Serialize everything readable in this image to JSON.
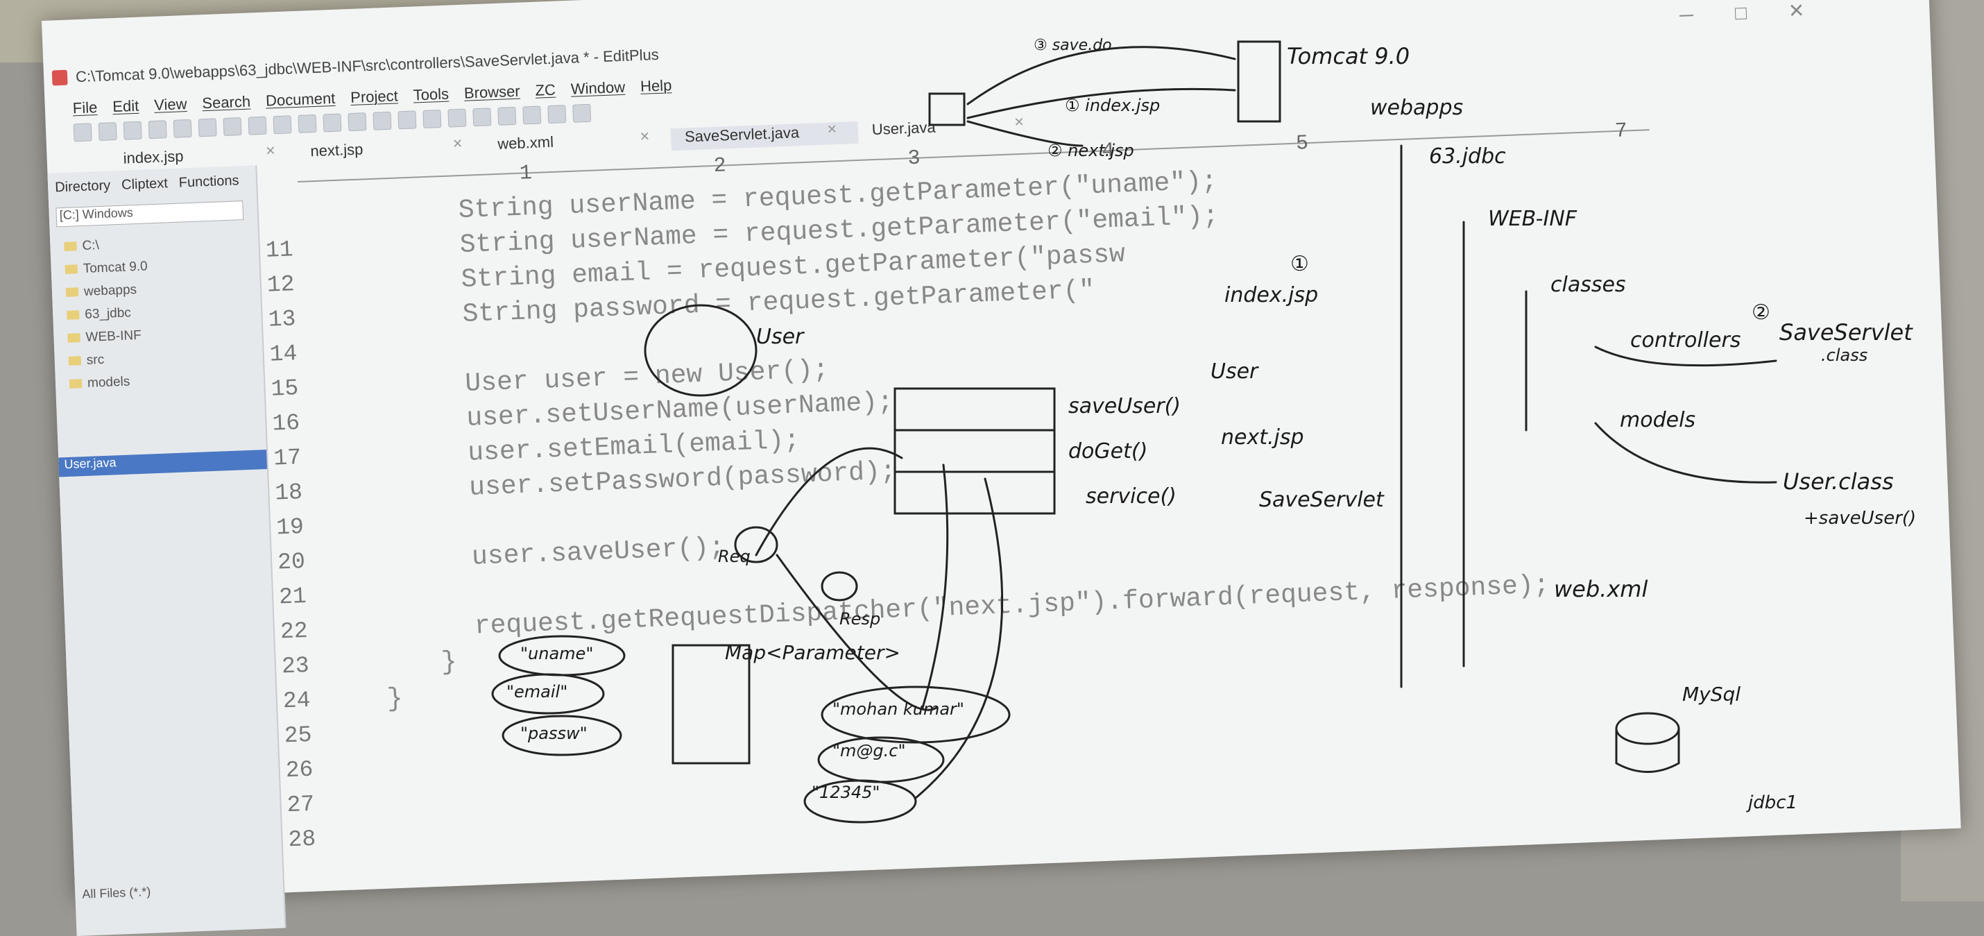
{
  "window": {
    "title": "C:\\Tomcat 9.0\\webapps\\63_jdbc\\WEB-INF\\src\\controllers\\SaveServlet.java * - EditPlus",
    "controls": [
      "─",
      "□",
      "✕"
    ]
  },
  "menu": [
    "File",
    "Edit",
    "View",
    "Search",
    "Document",
    "Project",
    "Tools",
    "Browser",
    "ZC",
    "Window",
    "Help"
  ],
  "tabs": [
    {
      "label": "index.jsp",
      "active": false
    },
    {
      "label": "next.jsp",
      "active": false
    },
    {
      "label": "web.xml",
      "active": false
    },
    {
      "label": "SaveServlet.java",
      "active": true
    },
    {
      "label": "User.java",
      "active": false
    }
  ],
  "sidebar": {
    "tabs": [
      "Directory",
      "Cliptext",
      "Functions"
    ],
    "drive": "[C:] Windows",
    "tree": [
      "C:\\",
      "Tomcat 9.0",
      "webapps",
      "63_jdbc",
      "WEB-INF",
      "src",
      "models"
    ],
    "selected_file": "User.java",
    "filter": "All Files (*.*)"
  },
  "ruler": [
    "1",
    "2",
    "3",
    "4",
    "5",
    "7"
  ],
  "code": [
    {
      "n": "",
      "text": "String userName = request.getParameter(\"uname\");"
    },
    {
      "n": "11",
      "text": "String userName = request.getParameter(\"email\");"
    },
    {
      "n": "12",
      "text": "String email = request.getParameter(\"passw"
    },
    {
      "n": "13",
      "text": "String password = request.getParameter(\""
    },
    {
      "n": "14",
      "text": ""
    },
    {
      "n": "15",
      "text": "User user = new User();"
    },
    {
      "n": "16",
      "text": "user.setUserName(userName);"
    },
    {
      "n": "17",
      "text": "user.setEmail(email);"
    },
    {
      "n": "18",
      "text": "user.setPassword(password);"
    },
    {
      "n": "19",
      "text": ""
    },
    {
      "n": "20",
      "text": "user.saveUser();"
    },
    {
      "n": "21",
      "text": ""
    },
    {
      "n": "22",
      "text": "request.getRequestDispatcher(\"next.jsp\").forward(request, response);"
    },
    {
      "n": "23",
      "text": "}"
    },
    {
      "n": "24",
      "text": "}"
    },
    {
      "n": "25",
      "text": ""
    },
    {
      "n": "26",
      "text": ""
    },
    {
      "n": "27",
      "text": ""
    },
    {
      "n": "28",
      "text": ""
    }
  ],
  "annotations": {
    "tomcat": "Tomcat 9.0",
    "webapps": "webapps",
    "jdbc": "63.jdbc",
    "webinf": "WEB-INF",
    "classes": "classes",
    "controllers": "controllers",
    "models": "models",
    "saveservlet": "SaveServlet",
    "saveservlet_ext": ".class",
    "userclass": "User.class",
    "saveuser_method": "+saveUser()",
    "webxml": "web.xml",
    "indexjsp": "index.jsp",
    "nextjsp": "next.jsp",
    "mysql": "MySql",
    "jdbc1": "jdbc1",
    "method_saveuser": "saveUser()",
    "method_doget": "doGet()",
    "method_service": "service()",
    "saveservlet_label": "SaveServlet",
    "user_label": "User",
    "user_label2": "User",
    "map": "Map<Parameter>",
    "req": "Req",
    "resp": "Resp",
    "req_arrow": "Req",
    "key1": "\"uname\"",
    "key2": "\"email\"",
    "key3": "\"passw\"",
    "val1": "\"mohan kumar\"",
    "val2": "\"m@g.c\"",
    "val3": "\"12345\"",
    "step_index": "① index.jsp",
    "step_next": "② next.jsp",
    "step_save": "③ save.do",
    "num1": "①",
    "num2": "②"
  }
}
